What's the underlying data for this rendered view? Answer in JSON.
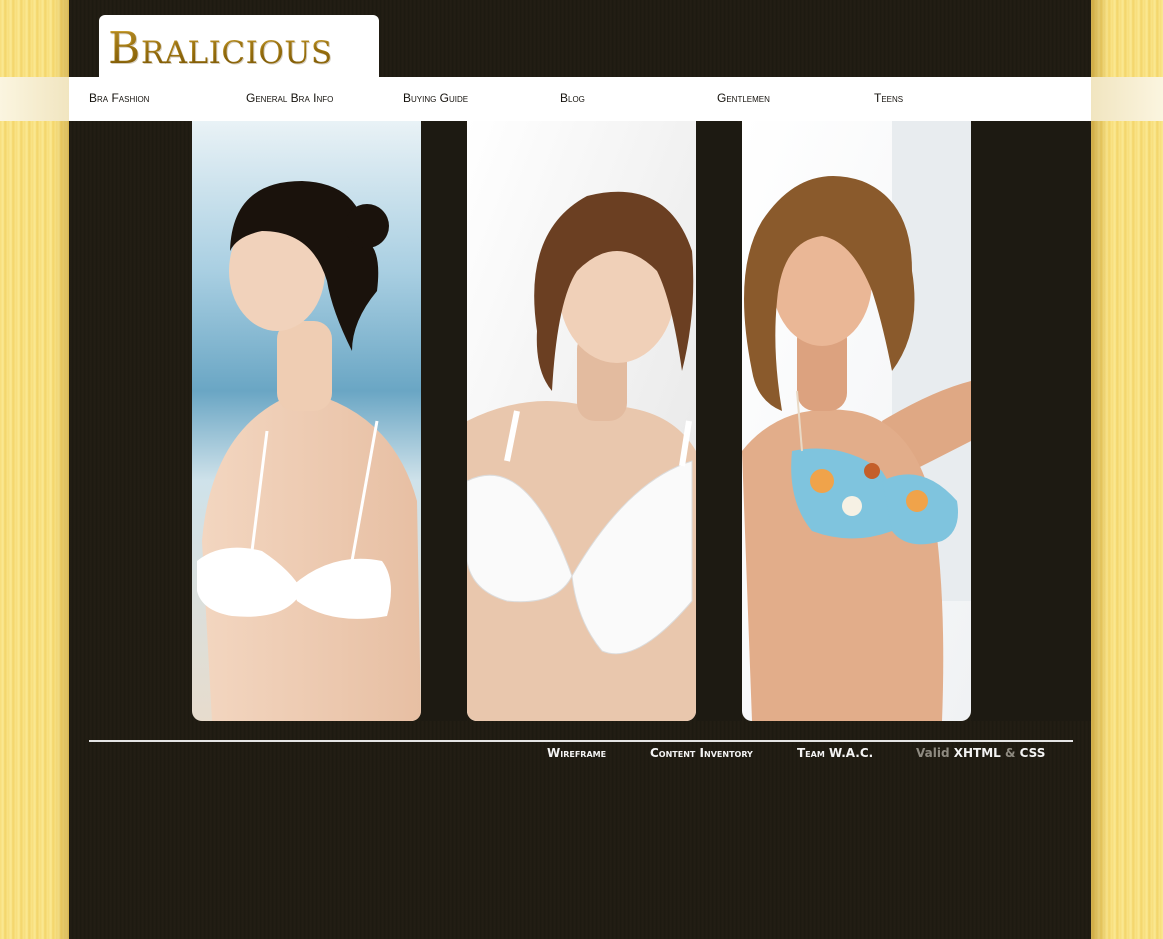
{
  "brand": {
    "logo_text": "Bralicious"
  },
  "nav": {
    "items": [
      {
        "label": "Bra Fashion"
      },
      {
        "label": "General Bra Info"
      },
      {
        "label": "Buying Guide"
      },
      {
        "label": "Blog"
      },
      {
        "label": "Gentlemen"
      },
      {
        "label": "Teens"
      }
    ]
  },
  "photos": [
    {
      "name": "model-photo-beach"
    },
    {
      "name": "model-photo-white-lace"
    },
    {
      "name": "model-photo-floral"
    }
  ],
  "footer": {
    "links": [
      {
        "label": "Wireframe"
      },
      {
        "label": "Content Inventory"
      },
      {
        "label": "Team W.A.C."
      }
    ],
    "valid_prefix": "Valid",
    "xhtml": "XHTML",
    "ampersand": "&",
    "css": "CSS"
  },
  "colors": {
    "page_bg": "#1f1b12",
    "side_bg": "#f7dd7a",
    "nav_bg": "#ffffff",
    "logo_gold": "#a67c12",
    "footer_text": "#f3f3f3"
  }
}
